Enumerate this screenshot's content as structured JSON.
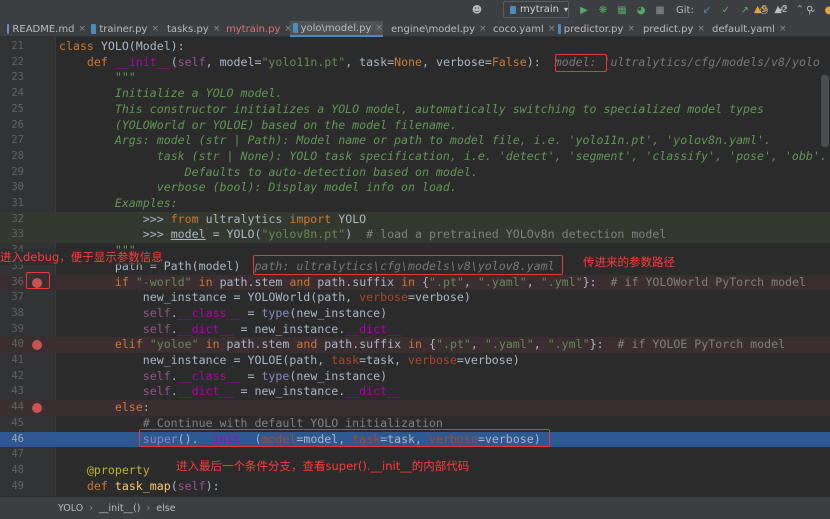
{
  "tabs": [
    {
      "label": "README.md",
      "icon": "markdown-file-icon",
      "color": "#6a8bd0",
      "active": false,
      "modified": false
    },
    {
      "label": "trainer.py",
      "icon": "python-file-icon",
      "color": "#4b8bbe",
      "active": false,
      "modified": false
    },
    {
      "label": "tasks.py",
      "icon": "python-file-icon",
      "color": "#4b8bbe",
      "active": false,
      "modified": false
    },
    {
      "label": "mytrain.py",
      "icon": "python-file-icon",
      "color": "#4b8bbe",
      "active": false,
      "modified": true
    },
    {
      "label": "yolo\\model.py",
      "icon": "python-file-icon",
      "color": "#4b8bbe",
      "active": true,
      "modified": false
    },
    {
      "label": "engine\\model.py",
      "icon": "python-file-icon",
      "color": "#4b8bbe",
      "active": false,
      "modified": false
    },
    {
      "label": "coco.yaml",
      "icon": "yaml-file-icon",
      "color": "#c97b40",
      "active": false,
      "modified": false
    },
    {
      "label": "predictor.py",
      "icon": "python-file-icon",
      "color": "#4b8bbe",
      "active": false,
      "modified": false
    },
    {
      "label": "predict.py",
      "icon": "python-file-icon",
      "color": "#4b8bbe",
      "active": false,
      "modified": false
    },
    {
      "label": "default.yaml",
      "icon": "yaml-file-icon",
      "color": "#c97b40",
      "active": false,
      "modified": false
    }
  ],
  "toolbar": {
    "run_config": "mytrain",
    "git_label": "Git:"
  },
  "inspections": {
    "warnings": "▲9",
    "weak": "▲2"
  },
  "lines": [
    {
      "n": "21",
      "html": "<span class=\"kw\">class</span> YOLO(Model):"
    },
    {
      "n": "22",
      "html": "    <span class=\"kw\">def</span> <span class=\"dn\">__init__</span>(<span class=\"sf\">self</span>, model=<span class=\"st\">\"yolo11n.pt\"</span>, task=<span class=\"kw\">None</span>, verbose=<span class=\"kw\">False</span>):  <span class=\"hint\">model: 'ultralytics/cfg/models/v8/yolo</span>"
    },
    {
      "n": "23",
      "html": "        <span class=\"dc\">\"\"\"</span>"
    },
    {
      "n": "24",
      "html": "        <span class=\"dc\">Initialize a YOLO model.</span>"
    },
    {
      "n": "25",
      "html": "        <span class=\"dc\">This constructor initializes a YOLO model, automatically switching to specialized model types</span>"
    },
    {
      "n": "26",
      "html": "        <span class=\"dc\">(YOLOWorld or YOLOE) based on the model filename.</span>"
    },
    {
      "n": "27",
      "html": "        <span class=\"dc\">Args: model (str | Path): Model name or path to model file, i.e. 'yolo11n.pt', 'yolov8n.yaml'.</span>"
    },
    {
      "n": "28",
      "html": "              <span class=\"dc\">task (str | None): YOLO task specification, i.e. 'detect', 'segment', 'classify', 'pose', 'obb'.</span>"
    },
    {
      "n": "29",
      "html": "                  <span class=\"dc\">Defaults to auto-detection based on model.</span>"
    },
    {
      "n": "30",
      "html": "              <span class=\"dc\">verbose (bool): Display model info on load.</span>"
    },
    {
      "n": "31",
      "html": "        <span class=\"dc\">Examples:</span>"
    },
    {
      "n": "32",
      "html": "            &gt;&gt;&gt; <span class=\"kw\">from</span> ultralytics <span class=\"kw\">import</span> YOLO",
      "cls": "doctest"
    },
    {
      "n": "33",
      "html": "            &gt;&gt;&gt; <span class=\"un\">model</span> = YOLO(<span class=\"st\">\"yolov8n.pt\"</span>)  <span class=\"cm\"># load a pretrained YOLOv8n detection model</span>",
      "cls": "doctest"
    },
    {
      "n": "34",
      "html": "        <span class=\"dc\">\"\"\"</span>"
    },
    {
      "n": "35",
      "html": "        path = Path(model)  <span class=\"hint\">path: ultralytics\\cfg\\models\\v8\\yolov8.yaml</span>"
    },
    {
      "n": "36",
      "html": "        <span class=\"kw\">if</span> <span class=\"st\">\"-world\"</span> <span class=\"kw\">in</span> path.stem <span class=\"kw\">and</span> path.suffix <span class=\"kw\">in</span> {<span class=\"st\">\".pt\"</span>, <span class=\"st\">\".yaml\"</span>, <span class=\"st\">\".yml\"</span>}:  <span class=\"cm\"># if YOLOWorld PyTorch model</span>",
      "cls": "bp",
      "bp": true
    },
    {
      "n": "37",
      "html": "            new_instance = YOLOWorld(path, <span class=\"pk\">verbose</span>=verbose)"
    },
    {
      "n": "38",
      "html": "            <span class=\"sf\">self</span>.<span class=\"dn\">__class__</span> = <span class=\"bi\">type</span>(new_instance)"
    },
    {
      "n": "39",
      "html": "            <span class=\"sf\">self</span>.<span class=\"dn\">__dict__</span> = new_instance.<span class=\"dn\">__dict__</span>"
    },
    {
      "n": "40",
      "html": "        <span class=\"kw\">elif</span> <span class=\"st\">\"yoloe\"</span> <span class=\"kw\">in</span> path.stem <span class=\"kw\">and</span> path.suffix <span class=\"kw\">in</span> {<span class=\"st\">\".pt\"</span>, <span class=\"st\">\".yaml\"</span>, <span class=\"st\">\".yml\"</span>}:  <span class=\"cm\"># if YOLOE PyTorch model</span>",
      "cls": "bp",
      "bp": true
    },
    {
      "n": "41",
      "html": "            new_instance = YOLOE(path, <span class=\"pk\">task</span>=task, <span class=\"pk\">verbose</span>=verbose)"
    },
    {
      "n": "42",
      "html": "            <span class=\"sf\">self</span>.<span class=\"dn\">__class__</span> = <span class=\"bi\">type</span>(new_instance)"
    },
    {
      "n": "43",
      "html": "            <span class=\"sf\">self</span>.<span class=\"dn\">__dict__</span> = new_instance.<span class=\"dn\">__dict__</span>"
    },
    {
      "n": "44",
      "html": "        <span class=\"kw\">else</span>:",
      "cls": "bp",
      "bp": true
    },
    {
      "n": "45",
      "html": "            <span class=\"cm\"># Continue with default YOLO initialization</span>"
    },
    {
      "n": "46",
      "html": "            <span class=\"bi\">super</span>().<span class=\"dn\">__init__</span>(<span class=\"pk\">model</span>=model, <span class=\"pk\">task</span>=task, <span class=\"pk\">verbose</span>=verbose)",
      "cls": "cur"
    },
    {
      "n": "47",
      "html": ""
    },
    {
      "n": "48",
      "html": "    <span class=\"dec\">@property</span>"
    },
    {
      "n": "49",
      "html": "    <span class=\"kw\">def</span> <span class=\"fn\">task_map</span>(<span class=\"sf\">self</span>):"
    }
  ],
  "annotations": {
    "debug_note": "进入debug，便于显示参数信息",
    "path_note": "传进来的参数路径",
    "branch_note": "进入最后一个条件分支，查看super().__init__的内部代码"
  },
  "breadcrumb": [
    "YOLO",
    "__init__()",
    "else"
  ]
}
